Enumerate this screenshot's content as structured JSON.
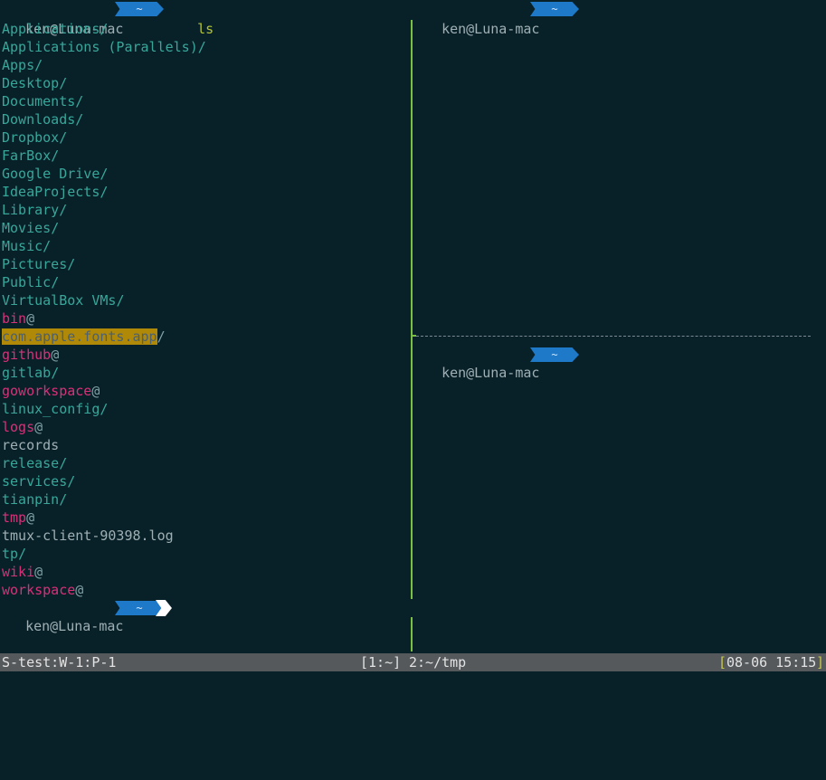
{
  "left_pane": {
    "prompt": {
      "host": "ken@Luna-mac",
      "dir": "~",
      "command": "ls"
    },
    "listing": [
      {
        "name": "Applications",
        "suffix": "/",
        "kind": "dir"
      },
      {
        "name": "Applications (Parallels)",
        "suffix": "/",
        "kind": "dir"
      },
      {
        "name": "Apps",
        "suffix": "/",
        "kind": "dir"
      },
      {
        "name": "Desktop",
        "suffix": "/",
        "kind": "dir"
      },
      {
        "name": "Documents",
        "suffix": "/",
        "kind": "dir"
      },
      {
        "name": "Downloads",
        "suffix": "/",
        "kind": "dir"
      },
      {
        "name": "Dropbox",
        "suffix": "/",
        "kind": "dir"
      },
      {
        "name": "FarBox",
        "suffix": "/",
        "kind": "dir"
      },
      {
        "name": "Google Drive",
        "suffix": "/",
        "kind": "dir"
      },
      {
        "name": "IdeaProjects",
        "suffix": "/",
        "kind": "dir"
      },
      {
        "name": "Library",
        "suffix": "/",
        "kind": "dir"
      },
      {
        "name": "Movies",
        "suffix": "/",
        "kind": "dir"
      },
      {
        "name": "Music",
        "suffix": "/",
        "kind": "dir"
      },
      {
        "name": "Pictures",
        "suffix": "/",
        "kind": "dir"
      },
      {
        "name": "Public",
        "suffix": "/",
        "kind": "dir"
      },
      {
        "name": "VirtualBox VMs",
        "suffix": "/",
        "kind": "dir"
      },
      {
        "name": "bin",
        "suffix": "@",
        "kind": "link"
      },
      {
        "name": "com.apple.fonts.app",
        "suffix": "/",
        "kind": "hl"
      },
      {
        "name": "github",
        "suffix": "@",
        "kind": "link"
      },
      {
        "name": "gitlab",
        "suffix": "/",
        "kind": "dir"
      },
      {
        "name": "goworkspace",
        "suffix": "@",
        "kind": "link"
      },
      {
        "name": "linux_config",
        "suffix": "/",
        "kind": "dir"
      },
      {
        "name": "logs",
        "suffix": "@",
        "kind": "link"
      },
      {
        "name": "records",
        "suffix": "",
        "kind": "plain"
      },
      {
        "name": "release",
        "suffix": "/",
        "kind": "dir"
      },
      {
        "name": "services",
        "suffix": "/",
        "kind": "dir"
      },
      {
        "name": "tianpin",
        "suffix": "/",
        "kind": "dir"
      },
      {
        "name": "tmp",
        "suffix": "@",
        "kind": "link"
      },
      {
        "name": "tmux-client-90398.log",
        "suffix": "",
        "kind": "plain"
      },
      {
        "name": "tp",
        "suffix": "/",
        "kind": "dir"
      },
      {
        "name": "wiki",
        "suffix": "@",
        "kind": "link"
      },
      {
        "name": "workspace",
        "suffix": "@",
        "kind": "link"
      }
    ],
    "bottom_prompt": {
      "host": "ken@Luna-mac",
      "dir": "~"
    }
  },
  "top_right_pane": {
    "prompt": {
      "host": "ken@Luna-mac",
      "dir": "~"
    }
  },
  "bottom_right_pane": {
    "prompt": {
      "host": "ken@Luna-mac",
      "dir": "~"
    }
  },
  "status_bar": {
    "session": "S-test:W-1:P-1",
    "window_active": "[1:~]",
    "window_other": "2:~/tmp",
    "open_bracket": "[",
    "datetime": "08-06 15:15",
    "close_bracket": "]"
  },
  "colors": {
    "background": "#082129",
    "directory": "#38a79a",
    "symlink": "#d7317a",
    "prompt_segment": "#1e79c8",
    "pane_separator": "#7ac043",
    "status_bar": "#55595c"
  }
}
